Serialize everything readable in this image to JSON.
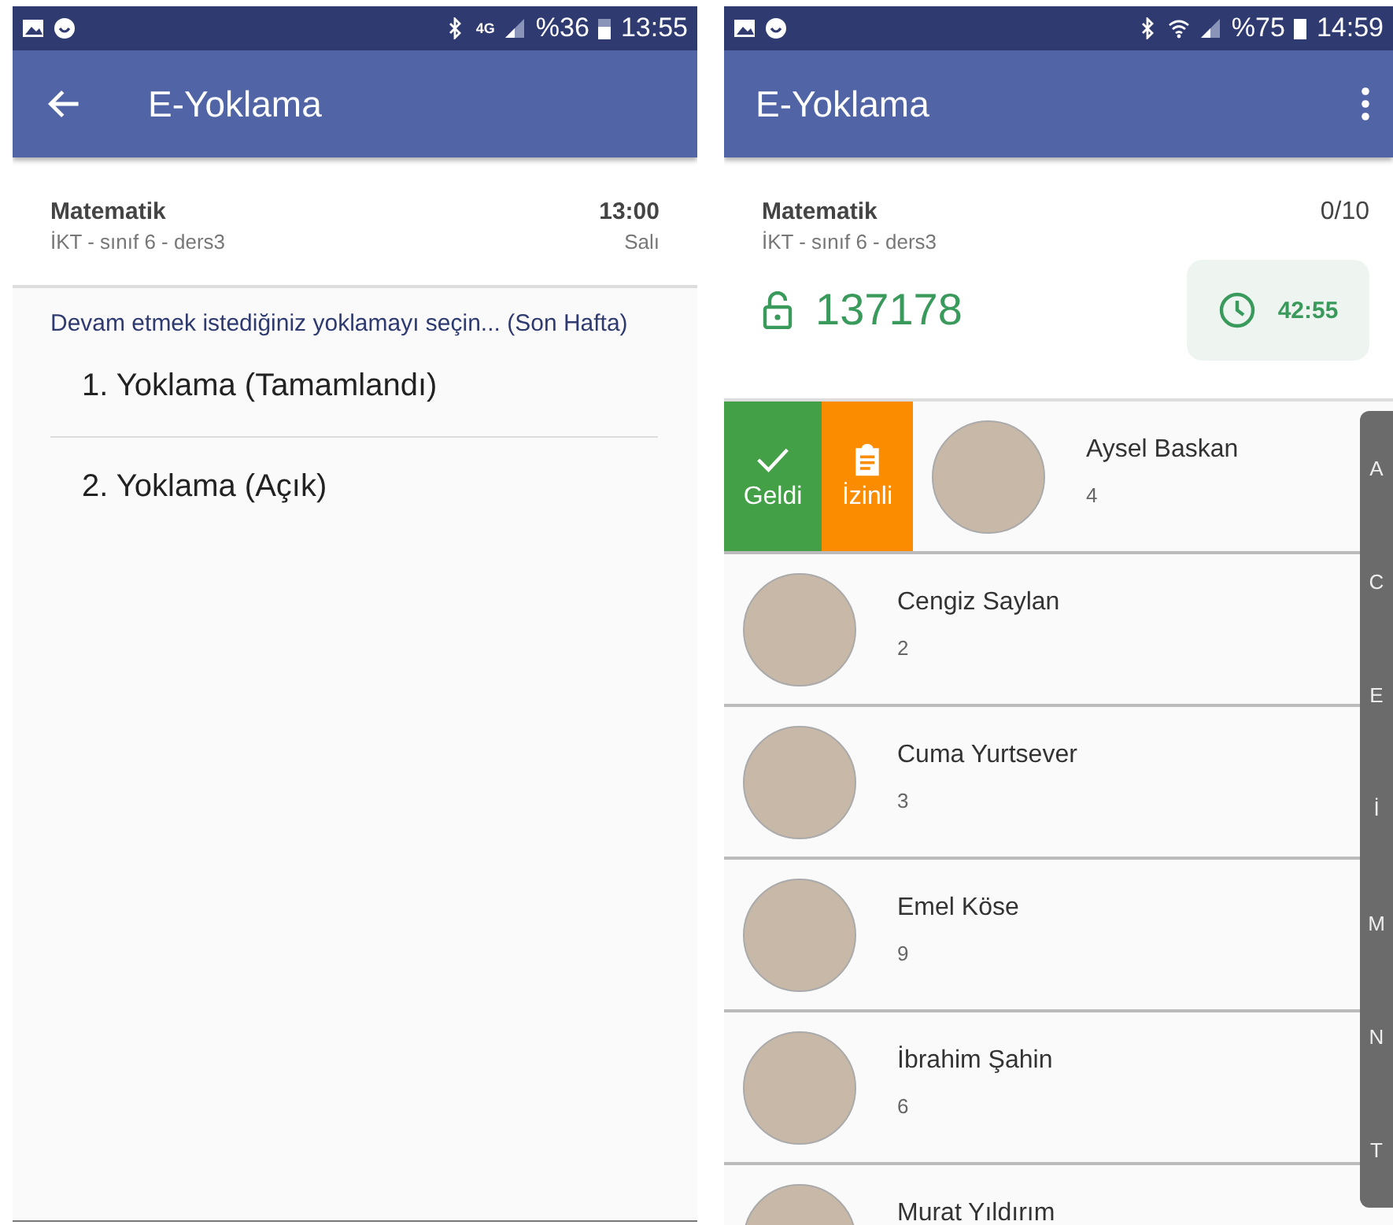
{
  "left_screen": {
    "status_bar": {
      "network": "4G",
      "battery": "%36",
      "time": "13:55"
    },
    "app_bar": {
      "title": "E-Yoklama"
    },
    "course": {
      "name": "Matematik",
      "details": "İKT - sınıf 6 - ders3",
      "time": "13:00",
      "day": "Salı"
    },
    "prompt": "Devam etmek istediğiniz yoklamayı seçin... (Son Hafta)",
    "sessions": [
      "1. Yoklama (Tamamlandı)",
      "2. Yoklama (Açık)"
    ]
  },
  "right_screen": {
    "status_bar": {
      "battery": "%75",
      "time": "14:59"
    },
    "app_bar": {
      "title": "E-Yoklama"
    },
    "course": {
      "name": "Matematik",
      "details": "İKT - sınıf 6 - ders3",
      "count": "0/10",
      "code": "137178",
      "timer": "42:55"
    },
    "students": [
      {
        "name": "Aysel Baskan",
        "number": "4",
        "actions": [
          "Geldi",
          "İzinli"
        ]
      },
      {
        "name": "Cengiz Saylan",
        "number": "2"
      },
      {
        "name": "Cuma Yurtsever",
        "number": "3"
      },
      {
        "name": "Emel Köse",
        "number": "9"
      },
      {
        "name": "İbrahim Şahin",
        "number": "6"
      },
      {
        "name": "Murat Yıldırım"
      }
    ],
    "index_letters": [
      "A",
      "C",
      "E",
      "İ",
      "M",
      "N",
      "T"
    ]
  }
}
